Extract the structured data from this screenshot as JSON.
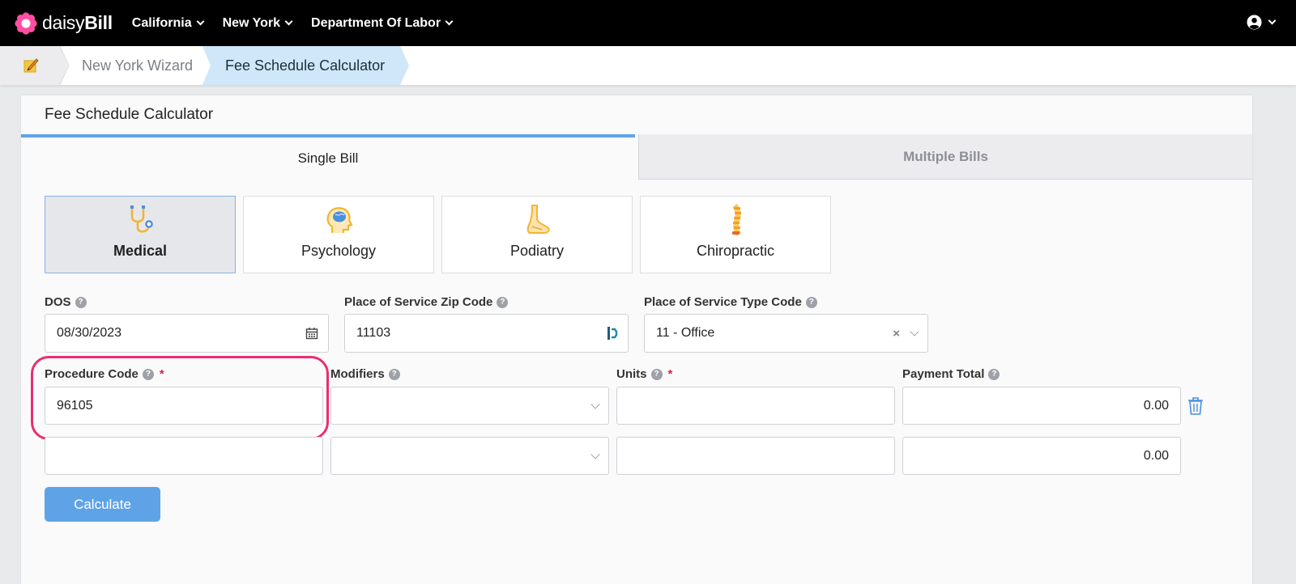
{
  "topnav": {
    "brand": {
      "light": "daisy",
      "bold": "Bill"
    },
    "items": [
      {
        "label": "California"
      },
      {
        "label": "New York"
      },
      {
        "label": "Department Of Labor"
      }
    ]
  },
  "breadcrumb": {
    "home_icon": "notepad-pencil-icon",
    "items": [
      "New York Wizard",
      "Fee Schedule Calculator"
    ]
  },
  "card": {
    "title": "Fee Schedule Calculator",
    "tabs": [
      {
        "label": "Single Bill",
        "active": true
      },
      {
        "label": "Multiple Bills",
        "active": false
      }
    ],
    "specialties": [
      {
        "label": "Medical",
        "icon": "stethoscope-icon",
        "active": true
      },
      {
        "label": "Psychology",
        "icon": "brain-head-icon",
        "active": false
      },
      {
        "label": "Podiatry",
        "icon": "foot-icon",
        "active": false
      },
      {
        "label": "Chiropractic",
        "icon": "spine-icon",
        "active": false
      }
    ],
    "form": {
      "dos": {
        "label": "DOS",
        "value": "08/30/2023"
      },
      "zip": {
        "label": "Place of Service Zip Code",
        "value": "11103"
      },
      "pos_type": {
        "label": "Place of Service Type Code",
        "value": "11 - Office"
      },
      "procedure_code": {
        "label": "Procedure Code",
        "required_mark": "*"
      },
      "modifiers": {
        "label": "Modifiers"
      },
      "units": {
        "label": "Units",
        "required_mark": "*"
      },
      "payment_total": {
        "label": "Payment Total"
      },
      "rows": [
        {
          "procedure_code": "96105",
          "modifiers": "",
          "units": "",
          "payment_total": "0.00"
        },
        {
          "procedure_code": "",
          "modifiers": "",
          "units": "",
          "payment_total": "0.00"
        }
      ]
    },
    "calculate_label": "Calculate"
  },
  "colors": {
    "accent": "#5fa3e6",
    "highlight": "#ea2e6e",
    "crumb_active": "#cfe7f8",
    "required": "#d9214c"
  }
}
